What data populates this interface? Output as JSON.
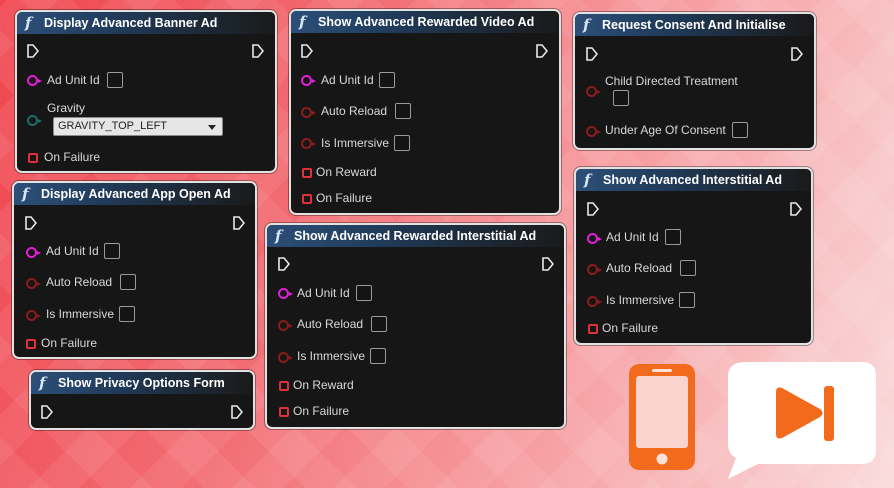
{
  "nodes": {
    "banner": {
      "title": "Display Advanced Banner Ad",
      "ad_unit_id": "Ad Unit Id",
      "gravity": "Gravity",
      "gravity_value": "GRAVITY_TOP_LEFT",
      "on_failure": "On Failure"
    },
    "rewarded_video": {
      "title": "Show Advanced Rewarded Video Ad",
      "ad_unit_id": "Ad Unit Id",
      "auto_reload": "Auto Reload",
      "is_immersive": "Is Immersive",
      "on_reward": "On Reward",
      "on_failure": "On Failure"
    },
    "consent": {
      "title": "Request Consent And Initialise",
      "child_directed": "Child Directed Treatment",
      "under_age": "Under Age Of Consent"
    },
    "app_open": {
      "title": "Display Advanced App Open Ad",
      "ad_unit_id": "Ad Unit Id",
      "auto_reload": "Auto Reload",
      "is_immersive": "Is Immersive",
      "on_failure": "On Failure"
    },
    "rewarded_interstitial": {
      "title": "Show Advanced Rewarded Interstitial Ad",
      "ad_unit_id": "Ad Unit Id",
      "auto_reload": "Auto Reload",
      "is_immersive": "Is Immersive",
      "on_reward": "On Reward",
      "on_failure": "On Failure"
    },
    "interstitial": {
      "title": "Show Advanced Interstitial Ad",
      "ad_unit_id": "Ad Unit Id",
      "auto_reload": "Auto Reload",
      "is_immersive": "Is Immersive",
      "on_failure": "On Failure"
    },
    "privacy": {
      "title": "Show Privacy Options Form"
    }
  },
  "function_icon": "f",
  "icons": {
    "phone": "smartphone-icon",
    "speech_bubble": "speech-bubble-skip-icon"
  },
  "colors": {
    "brand_orange": "#f26a1b",
    "node_header": "#2c4f78",
    "pin_magenta": "#e01fd6",
    "pin_red": "#e0303a"
  }
}
